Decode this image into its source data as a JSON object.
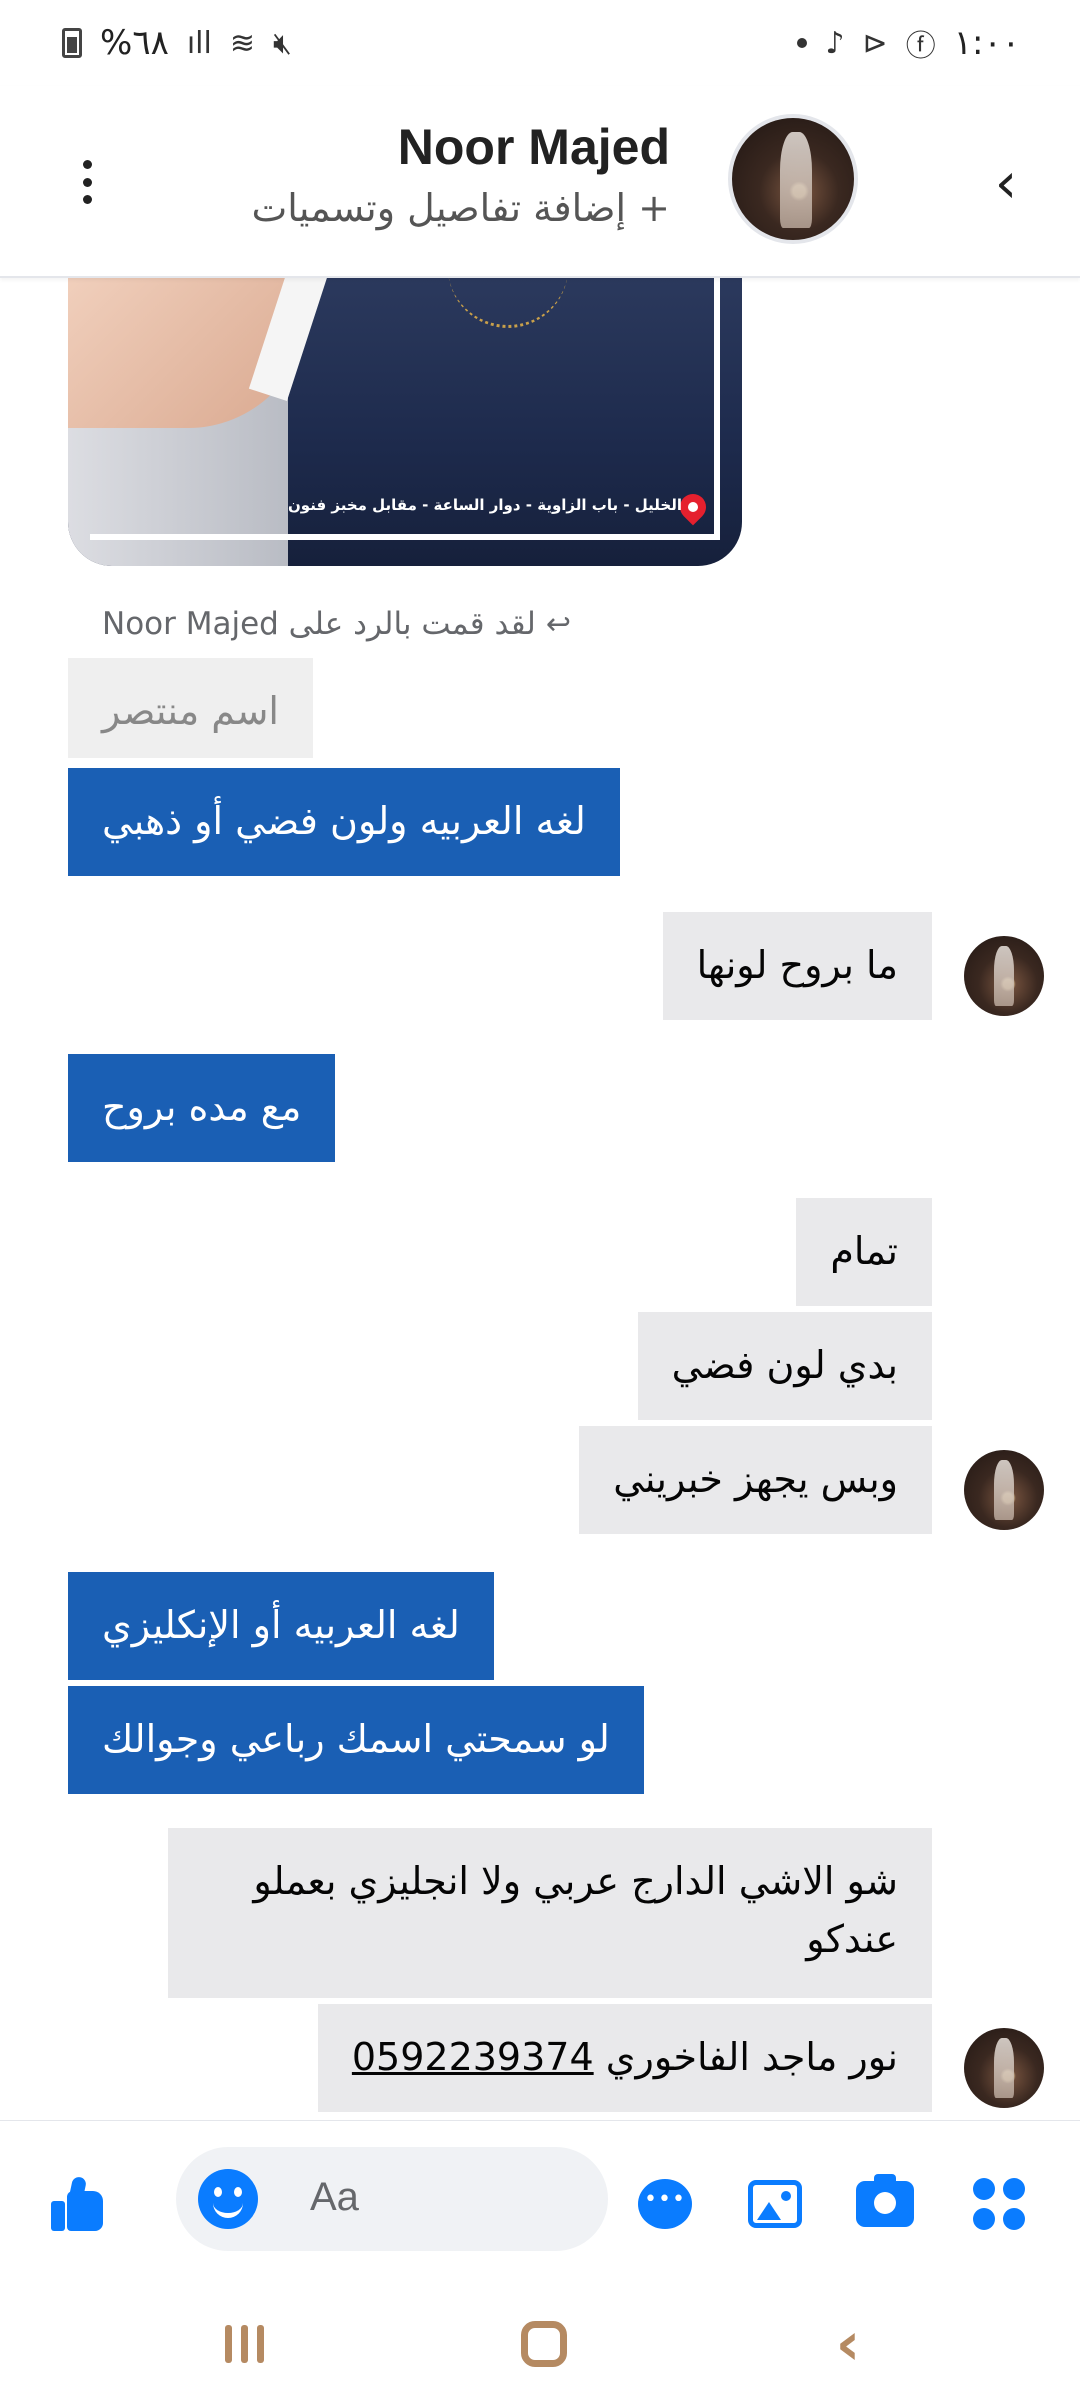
{
  "status_bar": {
    "battery_percent": "%٦٨",
    "signal_icon": "signal-icon",
    "wifi_icon": "wifi-icon",
    "mute_icon": "mute-icon",
    "time": "١:٠٠",
    "app_icons": [
      "tiktok-icon",
      "play-icon",
      "facebook-icon"
    ]
  },
  "header": {
    "contact_name": "Noor Majed",
    "subtitle": "+ إضافة تفاصيل وتسميات",
    "back_icon": "chevron-left-icon",
    "menu_icon": "more-vertical-icon"
  },
  "shared_image": {
    "caption": "الخليل - باب الزاوية - دوار الساعة - مقابل مخبز فنون"
  },
  "reply_note": "لقد قمت بالرد على Noor Majed",
  "messages": [
    {
      "id": "quoted",
      "direction": "quoted",
      "text": "اسم منتصر"
    },
    {
      "id": "m1",
      "direction": "out",
      "text": "لغه العربيه  ولون فضي أو ذهبي"
    },
    {
      "id": "m2",
      "direction": "in",
      "text": "ما بروح لونها"
    },
    {
      "id": "m3",
      "direction": "out",
      "text": "مع مده  بروح"
    },
    {
      "id": "m4",
      "direction": "in",
      "text": "تمام"
    },
    {
      "id": "m5",
      "direction": "in",
      "text": "بدي لون فضي"
    },
    {
      "id": "m6",
      "direction": "in",
      "text": "وبس يجهز خبريني"
    },
    {
      "id": "m7",
      "direction": "out",
      "text": "لغه العربيه أو الإنكليزي"
    },
    {
      "id": "m8",
      "direction": "out",
      "text": "لو سمحتي اسمك رباعي وجوالك"
    },
    {
      "id": "m9",
      "direction": "in",
      "text_line1": "شو الاشي الدارج عربي ولا انجليزي بعملو",
      "text_line2": "عندكو"
    },
    {
      "id": "m10",
      "direction": "in",
      "name_text": "نور ماجد الفاخوري",
      "phone": "0592239374"
    }
  ],
  "composer": {
    "placeholder": "Aa",
    "icons": [
      "apps-icon",
      "camera-icon",
      "gallery-icon",
      "chat-bubble-icon",
      "emoji-icon",
      "like-icon"
    ]
  },
  "colors": {
    "outgoing_bubble": "#1a5fb4",
    "incoming_bubble": "#e9e9eb",
    "accent": "#0a7cff"
  }
}
